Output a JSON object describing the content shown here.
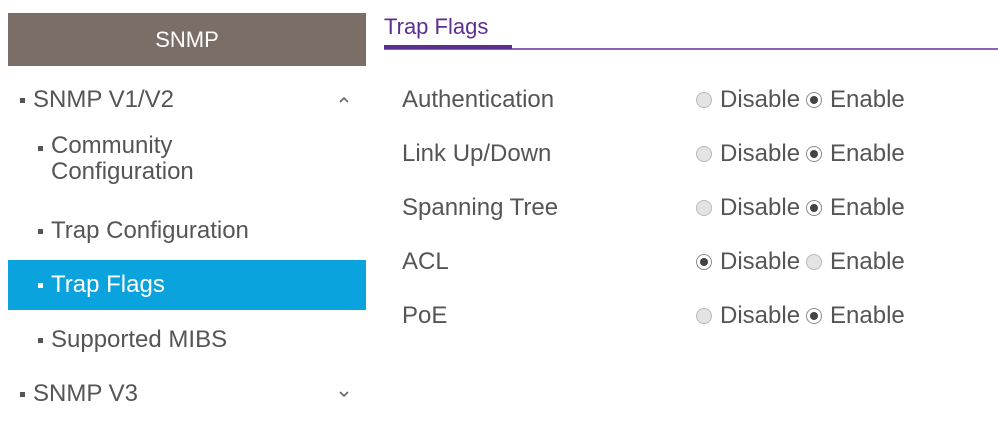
{
  "sidebar": {
    "header": "SNMP",
    "items": [
      {
        "label": "SNMP V1/V2",
        "level": 1,
        "chevron": "up"
      },
      {
        "label": "Community Configuration",
        "level": 2
      },
      {
        "label": "Trap Configuration",
        "level": 2
      },
      {
        "label": "Trap Flags",
        "level": 2,
        "active": true
      },
      {
        "label": "Supported MIBS",
        "level": 2
      },
      {
        "label": "SNMP V3",
        "level": 1,
        "chevron": "down"
      }
    ]
  },
  "main": {
    "title": "Trap Flags",
    "option_disable": "Disable",
    "option_enable": "Enable",
    "flags": [
      {
        "label": "Authentication",
        "value": "Enable"
      },
      {
        "label": "Link Up/Down",
        "value": "Enable"
      },
      {
        "label": "Spanning Tree",
        "value": "Enable"
      },
      {
        "label": "ACL",
        "value": "Disable"
      },
      {
        "label": "PoE",
        "value": "Enable"
      }
    ]
  },
  "colors": {
    "sidebar_header_bg": "#7a6e66",
    "active_item_bg": "#0aa3de",
    "title_accent": "#5c2f8e"
  }
}
